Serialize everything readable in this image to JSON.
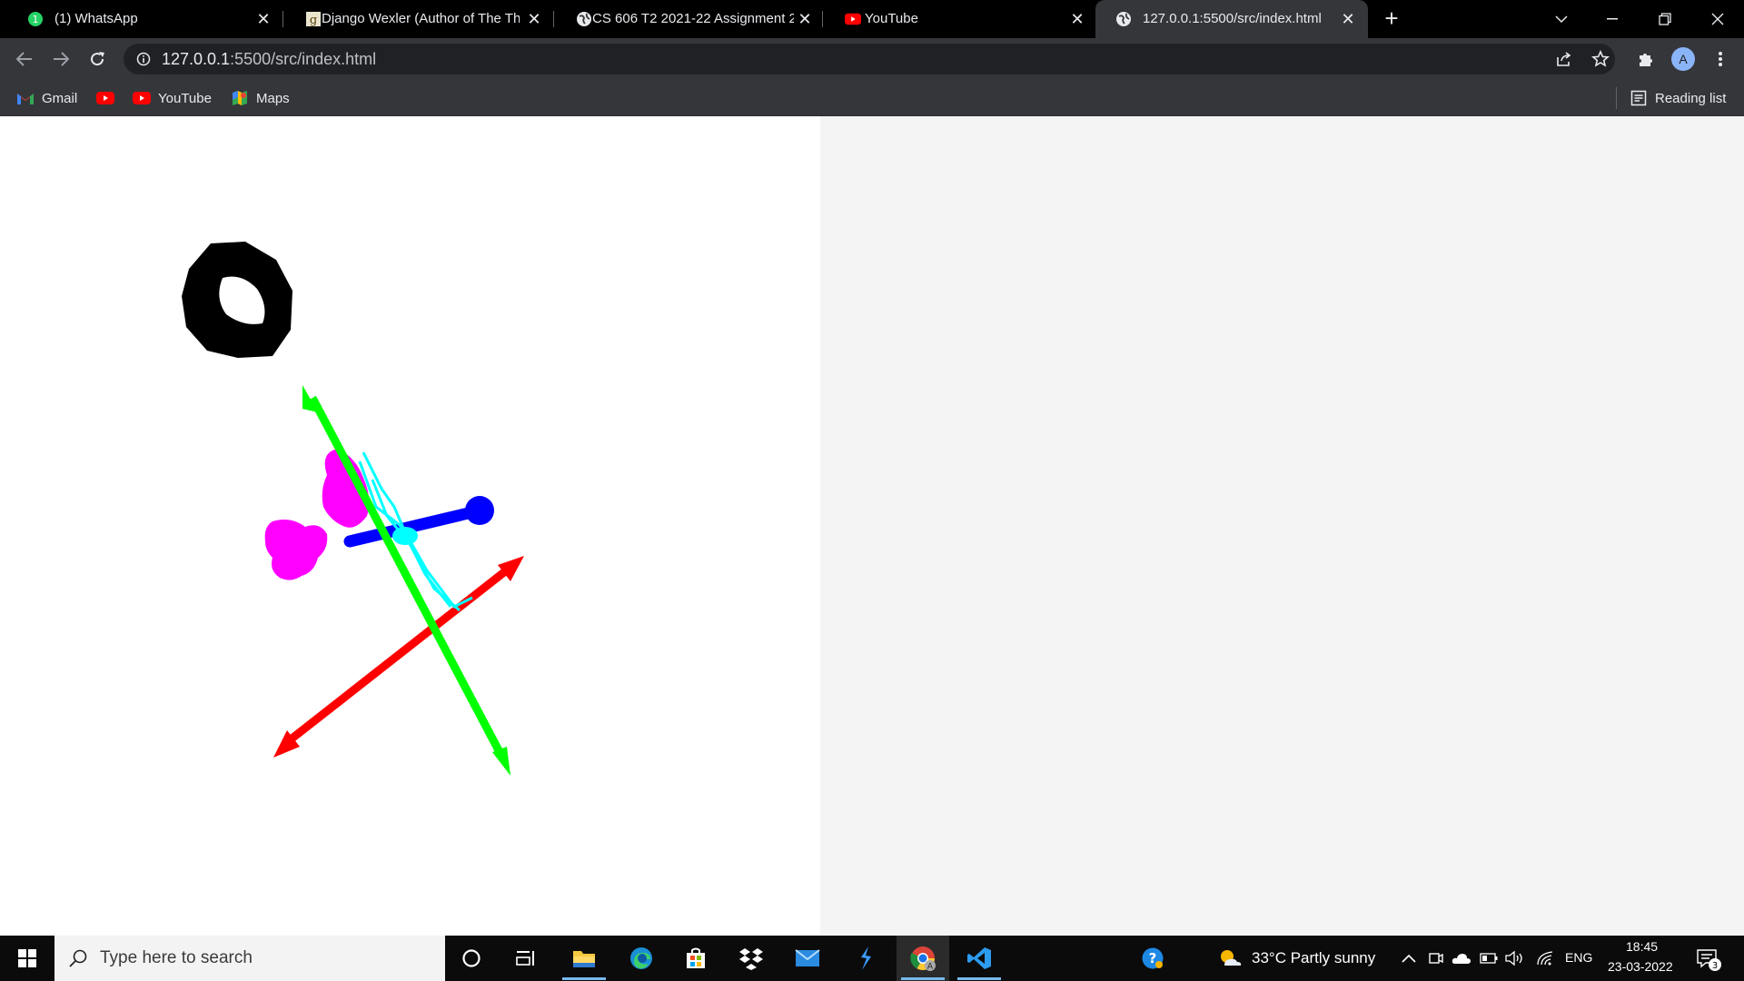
{
  "window": {
    "tabs": [
      {
        "title": "(1) WhatsApp",
        "favicon": "whatsapp-icon",
        "active": false
      },
      {
        "title": "Django Wexler (Author of The Th",
        "favicon": "goodreads-icon",
        "active": false
      },
      {
        "title": "CS 606 T2 2021-22 Assignment 2",
        "favicon": "globe-icon",
        "active": false
      },
      {
        "title": "YouTube",
        "favicon": "youtube-icon",
        "active": false
      },
      {
        "title": "127.0.0.1:5500/src/index.html",
        "favicon": "globe-icon",
        "active": true
      }
    ],
    "new_tab_label": "+"
  },
  "toolbar": {
    "url_host": "127.0.0.1",
    "url_rest": ":5500/src/index.html",
    "avatar_letter": "A"
  },
  "bookmarks": {
    "items": [
      {
        "label": "Gmail",
        "icon": "gmail-icon"
      },
      {
        "label": "",
        "icon": "youtube-icon"
      },
      {
        "label": "YouTube",
        "icon": "youtube-icon"
      },
      {
        "label": "Maps",
        "icon": "maps-icon"
      }
    ],
    "reading_list_label": "Reading list"
  },
  "scene": {
    "axis_colors": {
      "x": "#ff0000",
      "y": "#00ff00",
      "z": "#0000ff"
    },
    "ring_color": "#000000",
    "blob_color": "#ff00ff",
    "accent_color": "#00ffff",
    "right_pane_color": "#f4f4f4"
  },
  "taskbar": {
    "search_placeholder": "Type here to search",
    "weather": "33°C  Partly sunny",
    "language": "ENG",
    "time": "18:45",
    "date": "23-03-2022",
    "notification_count": "3"
  }
}
